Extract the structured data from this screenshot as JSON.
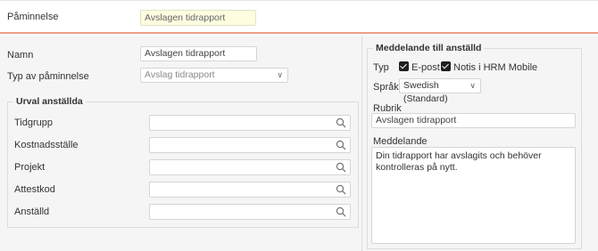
{
  "header": {
    "label": "Påminnelse",
    "title_value": "Avslagen tidrapport"
  },
  "left": {
    "name_label": "Namn",
    "name_value": "Avslagen tidrapport",
    "type_label": "Typ av påminnelse",
    "type_value": "Avslag tidrapport",
    "selection": {
      "legend": "Urval anställda",
      "fields": [
        {
          "label": "Tidgrupp",
          "value": ""
        },
        {
          "label": "Kostnadsställe",
          "value": ""
        },
        {
          "label": "Projekt",
          "value": ""
        },
        {
          "label": "Attestkod",
          "value": ""
        },
        {
          "label": "Anställd",
          "value": ""
        }
      ]
    }
  },
  "right": {
    "legend": "Meddelande till anställd",
    "type_label": "Typ",
    "email_label": "E-post",
    "email_checked": true,
    "hrm_label": "Notis i HRM Mobile",
    "hrm_checked": true,
    "language_label": "Språk",
    "language_value": "Swedish (Standard)",
    "subject_label": "Rubrik",
    "subject_value": "Avslagen tidrapport",
    "message_label": "Meddelande",
    "message_value": "Din tidrapport har avslagits och behöver kontrolleras på nytt."
  },
  "icons": {
    "lookup": "search-icon",
    "dropdown": "chevron-down-icon",
    "checkbox": "checkmark-icon"
  },
  "colors": {
    "accent": "#ef9f86",
    "highlight_input": "#fffde0"
  }
}
